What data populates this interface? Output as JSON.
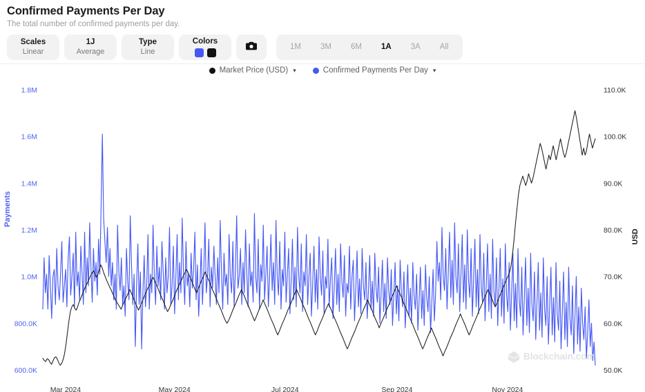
{
  "header": {
    "title": "Confirmed Payments Per Day",
    "subtitle": "The total number of confirmed payments per day."
  },
  "toolbar": {
    "controls": [
      {
        "name": "scales",
        "key": "Scales",
        "value": "Linear"
      },
      {
        "name": "interval",
        "key": "1J",
        "value": "Average"
      },
      {
        "name": "type",
        "key": "Type",
        "value": "Line"
      }
    ],
    "colors": {
      "key": "Colors",
      "swatches": [
        "#4558f4",
        "#111111"
      ]
    },
    "camera_icon": "camera-icon",
    "ranges": [
      {
        "label": "1M",
        "active": false
      },
      {
        "label": "3M",
        "active": false
      },
      {
        "label": "6M",
        "active": false
      },
      {
        "label": "1A",
        "active": true
      },
      {
        "label": "3A",
        "active": false
      },
      {
        "label": "All",
        "active": false
      }
    ]
  },
  "legend": [
    {
      "label": "Market Price (USD)",
      "color": "#111111",
      "icon": "chevron-down-icon"
    },
    {
      "label": "Confirmed Payments Per Day",
      "color": "#4558f4",
      "icon": "chevron-down-icon"
    }
  ],
  "watermark": "Blockchain.com",
  "chart_data": {
    "type": "line",
    "title": "Confirmed Payments Per Day",
    "subtitle": "The total number of confirmed payments per day.",
    "xlabel": "",
    "grid": false,
    "legend_position": "top-center",
    "x_ticks": [
      "Mar 2024",
      "May 2024",
      "Jul 2024",
      "Sep 2024",
      "Nov 2024"
    ],
    "x_tick_positions": [
      0.0411,
      0.2384,
      0.4384,
      0.6411,
      0.8411
    ],
    "axes": {
      "left": {
        "label": "Payments",
        "color": "#4f62f0",
        "ylim": [
          600000,
          1800000
        ],
        "ticks": [
          1800000,
          1600000,
          1400000,
          1200000,
          1000000,
          800000,
          600000
        ],
        "tick_labels": [
          "1.8M",
          "1.6M",
          "1.4M",
          "1.2M",
          "1.0M",
          "800.0K",
          "600.0K"
        ]
      },
      "right": {
        "label": "USD",
        "color": "#1b1b1b",
        "ylim": [
          50000,
          110000
        ],
        "ticks": [
          110000,
          100000,
          90000,
          80000,
          70000,
          60000,
          50000
        ],
        "tick_labels": [
          "110.0K",
          "100.0K",
          "90.0K",
          "80.0K",
          "70.0K",
          "60.0K",
          "50.0K"
        ]
      }
    },
    "series": [
      {
        "name": "Confirmed Payments Per Day",
        "axis": "left",
        "color": "#4558f4",
        "values": [
          860000,
          1080000,
          930000,
          1010000,
          860000,
          1090000,
          960000,
          820000,
          1000000,
          1030000,
          880000,
          1120000,
          960000,
          900000,
          1010000,
          1150000,
          890000,
          960000,
          1030000,
          870000,
          1080000,
          1170000,
          920000,
          1000000,
          1100000,
          870000,
          1190000,
          960000,
          1020000,
          900000,
          1130000,
          1010000,
          880000,
          1190000,
          930000,
          1080000,
          960000,
          1230000,
          1040000,
          890000,
          1120000,
          980000,
          1060000,
          920000,
          1160000,
          1010000,
          1300000,
          1610000,
          1250000,
          1150000,
          1060000,
          1210000,
          1000000,
          1120000,
          960000,
          1060000,
          900000,
          1010000,
          860000,
          1220000,
          1020000,
          940000,
          1080000,
          880000,
          960000,
          830000,
          1120000,
          980000,
          900000,
          1260000,
          1050000,
          880000,
          1010000,
          700000,
          960000,
          1140000,
          880000,
          1020000,
          690000,
          930000,
          1090000,
          870000,
          960000,
          1180000,
          860000,
          1010000,
          930000,
          1220000,
          1000000,
          880000,
          1130000,
          960000,
          1040000,
          900000,
          1150000,
          1020000,
          860000,
          1080000,
          930000,
          1000000,
          1210000,
          880000,
          960000,
          1130000,
          840000,
          1000000,
          1180000,
          900000,
          1060000,
          930000,
          1250000,
          1020000,
          880000,
          1150000,
          960000,
          1010000,
          870000,
          1100000,
          950000,
          1030000,
          1190000,
          900000,
          1050000,
          830000,
          960000,
          1120000,
          880000,
          1020000,
          1230000,
          930000,
          1000000,
          1160000,
          870000,
          1040000,
          950000,
          1130000,
          1000000,
          880000,
          1080000,
          930000,
          1240000,
          1020000,
          860000,
          1100000,
          960000,
          1010000,
          880000,
          1180000,
          1000000,
          930000,
          1150000,
          870000,
          1030000,
          1260000,
          950000,
          1000000,
          1120000,
          880000,
          1060000,
          930000,
          1200000,
          1010000,
          870000,
          1140000,
          960000,
          1020000,
          890000,
          1270000,
          1000000,
          930000,
          1160000,
          860000,
          1050000,
          980000,
          1220000,
          900000,
          1010000,
          1130000,
          870000,
          1000000,
          1180000,
          940000,
          1060000,
          880000,
          1240000,
          1000000,
          920000,
          1150000,
          860000,
          1030000,
          960000,
          1190000,
          890000,
          1010000,
          1120000,
          840000,
          980000,
          1160000,
          900000,
          1040000,
          870000,
          1210000,
          1000000,
          930000,
          1140000,
          850000,
          1020000,
          960000,
          1180000,
          880000,
          1000000,
          1100000,
          830000,
          970000,
          1130000,
          890000,
          1030000,
          860000,
          1170000,
          1000000,
          920000,
          1110000,
          840000,
          1000000,
          950000,
          1160000,
          870000,
          990000,
          1080000,
          820000,
          960000,
          1120000,
          880000,
          1010000,
          850000,
          1140000,
          980000,
          910000,
          1090000,
          830000,
          970000,
          930000,
          1130000,
          860000,
          1000000,
          1070000,
          810000,
          950000,
          1110000,
          870000,
          990000,
          840000,
          1120000,
          960000,
          900000,
          1060000,
          820000,
          940000,
          1090000,
          860000,
          980000,
          830000,
          1100000,
          950000,
          890000,
          1040000,
          800000,
          930000,
          1070000,
          850000,
          970000,
          820000,
          1080000,
          940000,
          880000,
          1030000,
          790000,
          920000,
          1060000,
          840000,
          960000,
          810000,
          1070000,
          930000,
          870000,
          1020000,
          780000,
          910000,
          1050000,
          830000,
          950000,
          800000,
          1060000,
          920000,
          860000,
          1010000,
          770000,
          900000,
          1040000,
          820000,
          940000,
          790000,
          1050000,
          910000,
          850000,
          1000000,
          760000,
          890000,
          1030000,
          810000,
          930000,
          1150000,
          980000,
          1060000,
          900000,
          1210000,
          1000000,
          940000,
          1120000,
          860000,
          1020000,
          1190000,
          910000,
          1070000,
          880000,
          1230000,
          1000000,
          930000,
          1140000,
          850000,
          1010000,
          1180000,
          890000,
          1050000,
          860000,
          1200000,
          980000,
          910000,
          1120000,
          830000,
          990000,
          1160000,
          870000,
          1030000,
          840000,
          1180000,
          960000,
          890000,
          1100000,
          810000,
          970000,
          1140000,
          850000,
          1010000,
          820000,
          1160000,
          940000,
          870000,
          1080000,
          790000,
          950000,
          1120000,
          830000,
          990000,
          800000,
          1140000,
          920000,
          850000,
          1060000,
          770000,
          930000,
          1100000,
          810000,
          970000,
          780000,
          1120000,
          900000,
          830000,
          1040000,
          750000,
          910000,
          1080000,
          790000,
          950000,
          760000,
          1100000,
          880000,
          810000,
          1020000,
          730000,
          890000,
          1060000,
          770000,
          930000,
          740000,
          1080000,
          860000,
          790000,
          1000000,
          710000,
          870000,
          1040000,
          750000,
          910000,
          720000,
          1060000,
          840000,
          770000,
          980000,
          690000,
          850000,
          1020000,
          730000,
          890000,
          700000,
          1040000,
          820000,
          750000,
          960000,
          670000,
          830000,
          1000000,
          710000,
          870000,
          680000,
          950000,
          800000,
          730000,
          870000,
          650000,
          760000,
          900000,
          700000,
          800000,
          640000,
          720000,
          620000
        ]
      },
      {
        "name": "Market Price (USD)",
        "axis": "right",
        "color": "#1b1b1b",
        "values": [
          52500,
          52000,
          51800,
          52400,
          52200,
          51600,
          51200,
          51900,
          52600,
          52800,
          52300,
          51500,
          51000,
          51400,
          52200,
          53500,
          55500,
          58000,
          60500,
          62500,
          63500,
          64000,
          63200,
          62800,
          63500,
          64500,
          65200,
          66000,
          66800,
          67500,
          68200,
          68800,
          69500,
          70200,
          70800,
          71200,
          70500,
          69800,
          70500,
          71500,
          72500,
          71800,
          70800,
          70000,
          69200,
          68500,
          67800,
          67200,
          66500,
          65800,
          65000,
          64500,
          64000,
          63500,
          63000,
          63800,
          64500,
          65200,
          65800,
          66500,
          67200,
          66500,
          65800,
          65000,
          64200,
          63500,
          62800,
          63500,
          64200,
          65000,
          65800,
          66500,
          67200,
          67800,
          68500,
          69200,
          69800,
          69200,
          68500,
          67800,
          67000,
          66200,
          65500,
          64800,
          64000,
          63200,
          62500,
          63000,
          63800,
          64500,
          65200,
          66000,
          66800,
          67500,
          68200,
          68800,
          69500,
          70200,
          70800,
          71500,
          71000,
          70200,
          69500,
          68800,
          68000,
          67200,
          66500,
          67200,
          68000,
          68800,
          69500,
          70200,
          71000,
          70200,
          69500,
          68800,
          68000,
          67200,
          66500,
          65800,
          65000,
          64200,
          63500,
          62800,
          62000,
          61200,
          60500,
          60000,
          60500,
          61200,
          62000,
          62800,
          63500,
          64200,
          65000,
          65800,
          66500,
          67200,
          66500,
          65800,
          65000,
          64200,
          63500,
          62800,
          62000,
          61200,
          60500,
          61200,
          62000,
          62800,
          63500,
          64200,
          65000,
          64200,
          63500,
          62800,
          62000,
          61200,
          60500,
          59800,
          59000,
          58200,
          57500,
          58200,
          59000,
          59800,
          60500,
          61200,
          62000,
          62800,
          63500,
          64200,
          65000,
          65800,
          66500,
          67200,
          66500,
          65800,
          65000,
          64200,
          63500,
          62800,
          62000,
          61200,
          60500,
          59800,
          59000,
          58200,
          57500,
          58200,
          59000,
          59800,
          60500,
          61200,
          62000,
          62800,
          63500,
          64200,
          63500,
          62800,
          62000,
          61200,
          60500,
          59800,
          59000,
          58200,
          57500,
          56800,
          56000,
          55200,
          54500,
          55200,
          56000,
          56800,
          57500,
          58200,
          59000,
          59800,
          60500,
          61200,
          62000,
          62800,
          63500,
          64200,
          65000,
          64200,
          63500,
          62800,
          62000,
          61200,
          60500,
          59800,
          59000,
          59800,
          60500,
          61200,
          62000,
          62800,
          63500,
          64200,
          65000,
          65800,
          66500,
          67200,
          68000,
          67200,
          66500,
          65800,
          65000,
          64200,
          63500,
          62800,
          62000,
          61200,
          60500,
          59800,
          59000,
          58200,
          57500,
          56800,
          56000,
          55200,
          54500,
          55200,
          56000,
          56800,
          57500,
          58200,
          59000,
          58200,
          57500,
          56800,
          56000,
          55200,
          54500,
          53800,
          53000,
          53800,
          54500,
          55200,
          56000,
          56800,
          57500,
          58200,
          59000,
          59800,
          60500,
          61200,
          62000,
          61200,
          60500,
          59800,
          59000,
          58200,
          57500,
          58200,
          59000,
          59800,
          60500,
          61200,
          62000,
          62800,
          63500,
          64200,
          65000,
          65800,
          66500,
          67200,
          66500,
          65800,
          65000,
          64200,
          63500,
          64200,
          65000,
          65800,
          66500,
          67200,
          68000,
          68800,
          69500,
          70200,
          71000,
          72500,
          75000,
          78000,
          81500,
          84500,
          87500,
          89500,
          90500,
          91500,
          90500,
          89500,
          90500,
          92000,
          91000,
          90000,
          91000,
          92500,
          94000,
          95500,
          97000,
          98500,
          97500,
          96000,
          94500,
          93000,
          94500,
          96000,
          95000,
          96500,
          98000,
          96500,
          95000,
          96500,
          98000,
          99500,
          98000,
          96500,
          95500,
          96500,
          98000,
          99500,
          101000,
          102500,
          104000,
          105500,
          104000,
          102000,
          100000,
          98000,
          96000,
          97500,
          96000,
          97000,
          99000,
          100500,
          99000,
          97500,
          98500,
          99500
        ]
      }
    ]
  }
}
